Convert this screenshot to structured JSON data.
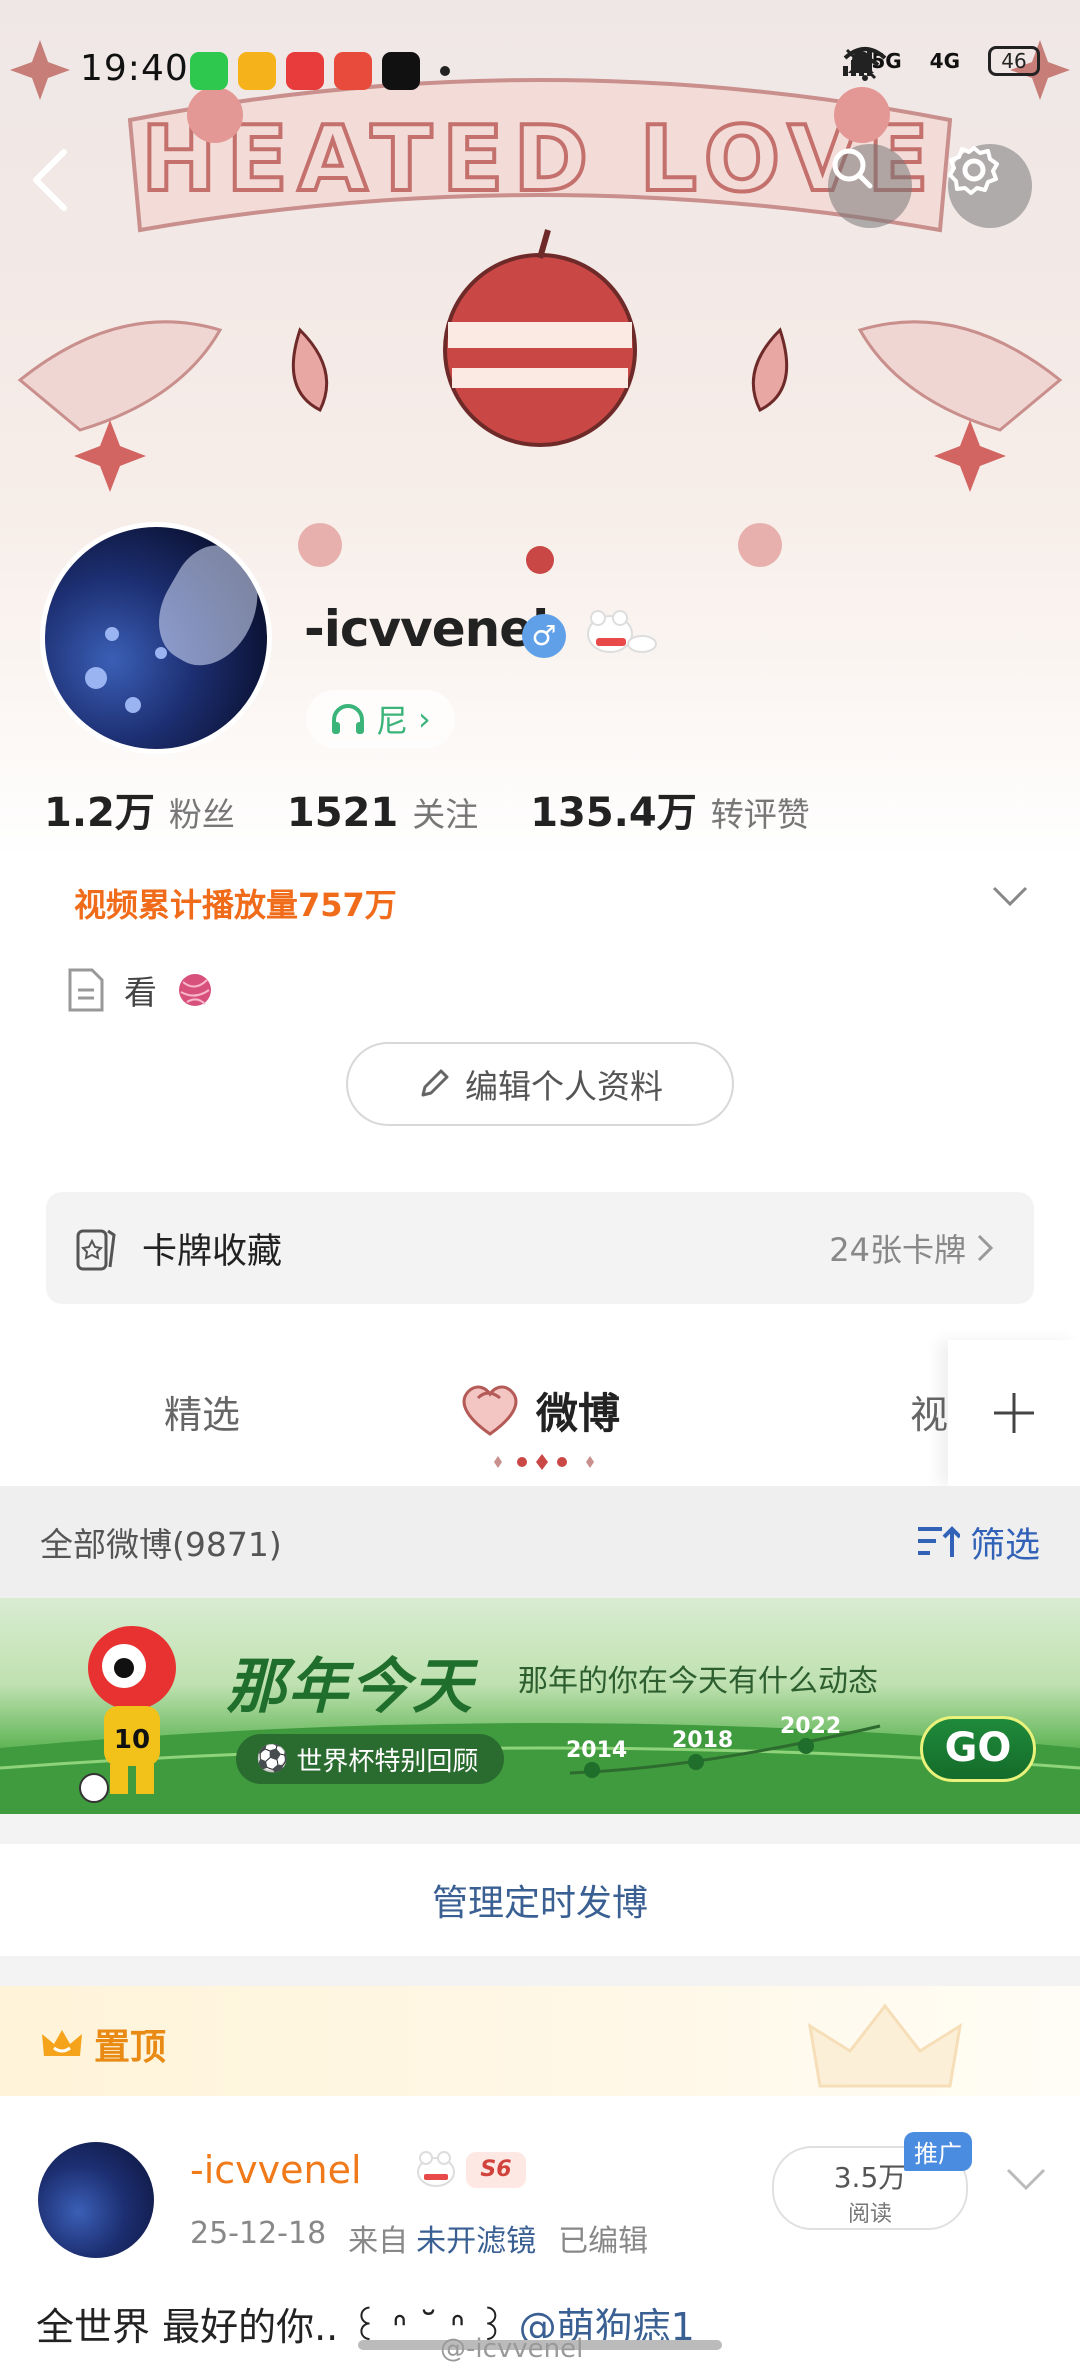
{
  "status_bar": {
    "time": "19:40",
    "signal_1": "5G",
    "signal_2": "4G",
    "battery": "46"
  },
  "banner": {
    "artwork_text": "HEATED LOVE"
  },
  "profile": {
    "username": "-icvvenel",
    "gender_symbol": "♂",
    "music_label": "尼",
    "music_chevron": "›",
    "stats": [
      {
        "value": "1.2万",
        "label": "粉丝"
      },
      {
        "value": "1521",
        "label": "关注"
      },
      {
        "value": "135.4万",
        "label": "转评赞"
      }
    ],
    "video_plays": "视频累计播放量757万",
    "bio": "看",
    "edit_button": "编辑个人资料"
  },
  "card_collection": {
    "title": "卡牌收藏",
    "count": "24张卡牌"
  },
  "tabs": {
    "items": [
      "精选",
      "微博",
      "视"
    ],
    "active": "微博"
  },
  "filter_bar": {
    "all_posts": "全部微博(9871)",
    "filter_label": "筛选"
  },
  "promo": {
    "title": "那年今天",
    "subtitle": "那年的你在今天有什么动态",
    "tag": "世界杯特别回顾",
    "years": [
      "2014",
      "2018",
      "2022"
    ],
    "go": "GO",
    "jersey_number": "10"
  },
  "manage_scheduled": "管理定时发博",
  "pinned_post": {
    "pin_label": "置顶",
    "author": "-icvvenel",
    "level_badge": "S6",
    "date": "25-12-18",
    "source_prefix": "来自",
    "source": "未开滤镜",
    "edited": "已编辑",
    "reads": "3.5万",
    "reads_label": "阅读",
    "promote": "推广",
    "text": "全世界 最好的你.. ꒰ ᐢ ˘ ᐢ ꒱ ",
    "mention": "@萌狗痣1"
  },
  "watermark": "@-icvvenel",
  "colors": {
    "accent_orange": "#f06b1a",
    "link_blue": "#3a5f92",
    "filter_blue": "#3262b8",
    "music_green": "#3bb47a",
    "promo_green": "#1f6e2c"
  }
}
